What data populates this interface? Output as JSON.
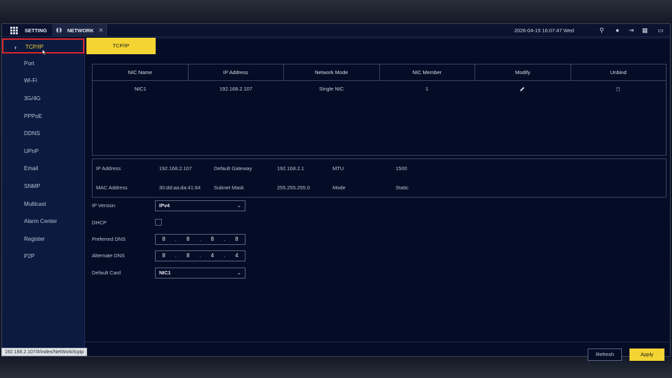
{
  "topbar": {
    "setting_label": "SETTING",
    "network_label": "NETWORK",
    "datetime": "2026-04-15 16:07:47 Wed",
    "icons": [
      "search-icon",
      "user-icon",
      "logout-icon",
      "qr-icon",
      "monitor-icon"
    ]
  },
  "sidebar": {
    "items": [
      {
        "label": "TCP/IP",
        "active": true
      },
      {
        "label": "Port"
      },
      {
        "label": "Wi-Fi"
      },
      {
        "label": "3G/4G"
      },
      {
        "label": "PPPoE"
      },
      {
        "label": "DDNS"
      },
      {
        "label": "UPnP"
      },
      {
        "label": "Email"
      },
      {
        "label": "SNMP"
      },
      {
        "label": "Multicast"
      },
      {
        "label": "Alarm Center"
      },
      {
        "label": "Register"
      },
      {
        "label": "P2P"
      }
    ]
  },
  "subtab": "TCP/IP",
  "nic_table": {
    "headers": [
      "NIC Name",
      "IP Address",
      "Network Mode",
      "NIC Member",
      "Modify",
      "Unbind"
    ],
    "rows": [
      {
        "name": "NIC1",
        "ip": "192.168.2.107",
        "mode": "Single NIC",
        "member": "1"
      }
    ]
  },
  "info": {
    "ip_label": "IP Address",
    "ip_value": "192.168.2.107",
    "gateway_label": "Default Gateway",
    "gateway_value": "192.168.2.1",
    "mtu_label": "MTU",
    "mtu_value": "1500",
    "mac_label": "MAC Address",
    "mac_value": "30:dd:aa:da:41:64",
    "mask_label": "Subnet Mask",
    "mask_value": "255.255.255.0",
    "mode_label": "Mode",
    "mode_value": "Static"
  },
  "form": {
    "ip_version_label": "IP Version",
    "ip_version_value": "IPv4",
    "dhcp_label": "DHCP",
    "preferred_dns_label": "Preferred DNS",
    "preferred_dns": [
      "8",
      "8",
      "8",
      "8"
    ],
    "alternate_dns_label": "Alternate DNS",
    "alternate_dns": [
      "8",
      "8",
      "4",
      "4"
    ],
    "default_card_label": "Default Card",
    "default_card_value": "NIC1"
  },
  "buttons": {
    "refresh": "Refresh",
    "apply": "Apply"
  },
  "status_url": "192.168.2.107/#/index/NetWork/tcpip",
  "colors": {
    "accent": "#f4d433",
    "highlight_border": "#e0262a",
    "background": "#050d26"
  }
}
